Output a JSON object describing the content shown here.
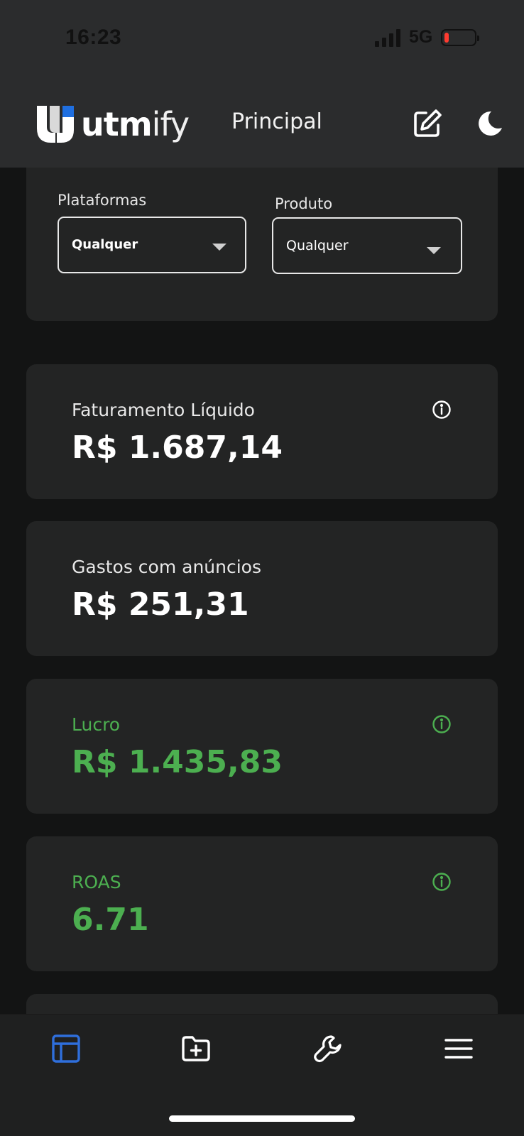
{
  "status_bar": {
    "time": "16:23",
    "network": "5G",
    "battery_level": 0.1
  },
  "header": {
    "logo_text_bold": "utm",
    "logo_text_light": "ify",
    "title": "Principal",
    "edit_icon": "edit-icon",
    "theme_icon": "moon-icon"
  },
  "filters": {
    "platforms": {
      "label": "Plataformas",
      "selected": "Qualquer"
    },
    "product": {
      "label": "Produto",
      "selected": "Qualquer"
    }
  },
  "metrics": [
    {
      "label": "Faturamento Líquido",
      "value": "R$ 1.687,14",
      "has_info": true,
      "color": "#ffffff"
    },
    {
      "label": "Gastos com anúncios",
      "value": "R$ 251,31",
      "has_info": false,
      "color": "#ffffff"
    },
    {
      "label": "Lucro",
      "value": "R$ 1.435,83",
      "has_info": true,
      "color": "#4caf50"
    },
    {
      "label": "ROAS",
      "value": "6.71",
      "has_info": true,
      "color": "#4caf50"
    }
  ],
  "bottom_nav": [
    {
      "name": "dashboard",
      "icon": "layout-icon",
      "active": true
    },
    {
      "name": "add-folder",
      "icon": "folder-plus-icon",
      "active": false
    },
    {
      "name": "tools",
      "icon": "wrench-icon",
      "active": false
    },
    {
      "name": "menu",
      "icon": "hamburger-menu-icon",
      "active": false
    }
  ],
  "colors": {
    "accent_active": "#2f6fdc",
    "positive": "#4caf50",
    "card_bg": "#232424",
    "page_bg": "#131414"
  }
}
